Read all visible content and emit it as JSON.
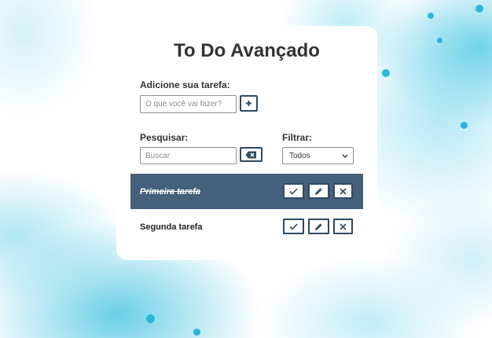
{
  "app": {
    "title": "To Do Avançado"
  },
  "add_section": {
    "label": "Adicione sua tarefa:",
    "input_placeholder": "O que você vai fazer?",
    "input_value": "",
    "add_button_icon": "plus-icon"
  },
  "search_section": {
    "label": "Pesquisar:",
    "input_placeholder": "Buscar",
    "input_value": "",
    "clear_button_icon": "backspace-icon"
  },
  "filter_section": {
    "label": "Filtrar:",
    "selected": "Todos"
  },
  "tasks": [
    {
      "title": "Primeira tarefa",
      "done": true
    },
    {
      "title": "Segunda tarefa",
      "done": false
    }
  ],
  "task_action_icons": [
    "check-icon",
    "pencil-icon",
    "close-icon"
  ],
  "colors": {
    "primary": "#2f4a63",
    "done_row": "#44607a",
    "background_accent": "#2bb6dc",
    "text": "#333333"
  }
}
